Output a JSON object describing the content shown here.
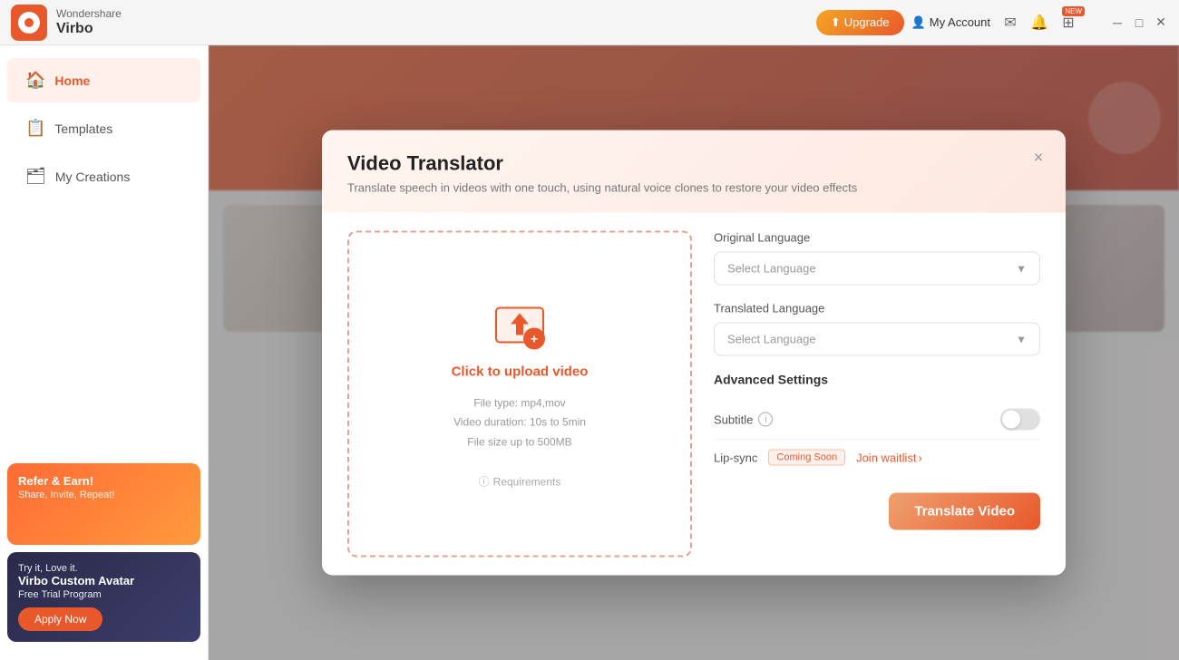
{
  "app": {
    "brand": "Wondershare",
    "product": "Virbo",
    "logo_alt": "Virbo Logo"
  },
  "titlebar": {
    "upgrade_label": "Upgrade",
    "account_label": "My Account",
    "new_badge": "NEW"
  },
  "sidebar": {
    "items": [
      {
        "id": "home",
        "label": "Home",
        "icon": "🏠",
        "active": true
      },
      {
        "id": "templates",
        "label": "Templates",
        "icon": "📋",
        "active": false
      },
      {
        "id": "my-creations",
        "label": "My Creations",
        "icon": "🗂",
        "active": false
      }
    ],
    "promo_refer": {
      "title": "Refer & Earn!",
      "subtitle": "Share, Invite, Repeat!"
    },
    "promo_trial": {
      "eyebrow": "Try it, Love it.",
      "title": "Virbo Custom Avatar",
      "subtitle": "Free Trial Program",
      "cta": "Apply Now"
    }
  },
  "modal": {
    "title": "Video Translator",
    "subtitle": "Translate speech in videos with one touch, using natural voice clones to restore your video effects",
    "close_label": "×",
    "upload": {
      "cta": "Click to upload video",
      "file_type": "File type: mp4,mov",
      "duration": "Video duration: 10s to  5min",
      "size": "File size up to  500MB",
      "requirements": "Requirements"
    },
    "settings": {
      "original_language_label": "Original Language",
      "original_language_placeholder": "Select Language",
      "translated_language_label": "Translated Language",
      "translated_language_placeholder": "Select Language",
      "advanced_label": "Advanced Settings",
      "subtitle_label": "Subtitle",
      "lipsync_label": "Lip-sync",
      "coming_soon": "Coming Soon",
      "join_waitlist": "Join waitlist",
      "translate_btn": "Translate Video"
    }
  }
}
